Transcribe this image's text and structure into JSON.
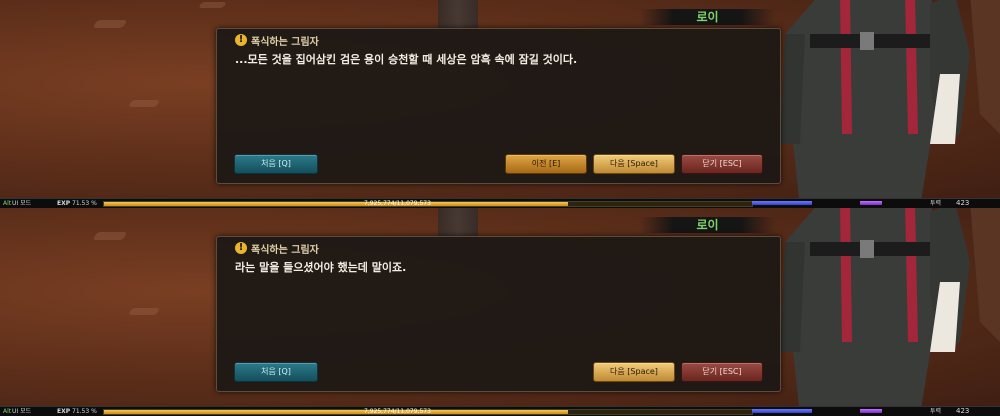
{
  "panels": [
    {
      "nameplate": "로이",
      "speaker": "폭식하는 그림자",
      "line": "...모든 것을 집어삼킨 검은 용이 승천할 때 세상은 암흑 속에 잠길 것이다.",
      "buttons": {
        "first": "처음 [Q]",
        "prev": "이전 [E]",
        "next": "다음 [Space]",
        "close": "닫기 [ESC]"
      },
      "status": {
        "alt": "Alt",
        "ui_mode": "UI 모드",
        "exp_label": "EXP",
        "exp_percent": "71.53 %",
        "exp_progress": 0.7153,
        "exp_numbers": "7,925,774/11,079,573",
        "stamina_label": "투력",
        "stamina_value": "423"
      }
    },
    {
      "nameplate": "로이",
      "speaker": "폭식하는 그림자",
      "line": "라는 말을 들으셨어야 했는데 말이죠.",
      "buttons": {
        "first": "처음 [Q]",
        "next": "다음 [Space]",
        "close": "닫기 [ESC]"
      },
      "status": {
        "alt": "Alt",
        "ui_mode": "UI 모드",
        "exp_label": "EXP",
        "exp_percent": "71.53 %",
        "exp_progress": 0.7153,
        "exp_numbers": "7,925,774/11,079,573",
        "stamina_label": "투력",
        "stamina_value": "423"
      }
    }
  ],
  "colors": {
    "speaker_accent": "#e8b52d",
    "nameplate": "#7fd36b",
    "exp_bar": "#f6c75a"
  }
}
